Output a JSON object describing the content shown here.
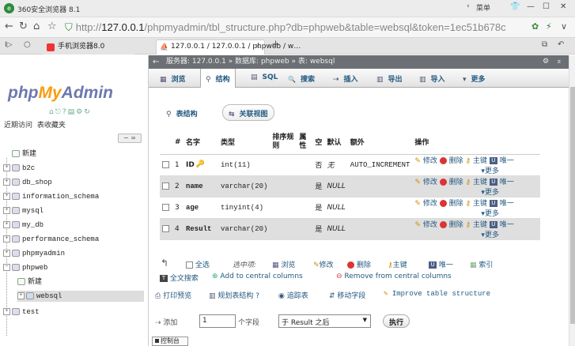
{
  "browser": {
    "title": "360安全浏览器 8.1",
    "menu_label": "菜单",
    "controls": {
      "minimize": "—",
      "maximize": "☐",
      "close": "✕"
    },
    "url_prefix": "http://",
    "url_host": "127.0.0.1",
    "url_rest": "/phpmyadmin/tbl_structure.php?db=phpweb&table=websql&token=1ec51b678c",
    "tabs": [
      {
        "label": "手机浏览器8.0",
        "active": false
      },
      {
        "label": "127.0.0.1 / 127.0.0.1 / phpweb / w…",
        "active": true
      }
    ],
    "new_tab": "+"
  },
  "left": {
    "logo_php": "php",
    "logo_my": "My",
    "logo_admin": "Admin",
    "recent": "近期访问",
    "favorites": "表收藏夹",
    "tree": [
      {
        "label": "新建",
        "expander": "",
        "level": 0
      },
      {
        "label": "b2c",
        "expander": "+",
        "level": 0
      },
      {
        "label": "db_shop",
        "expander": "+",
        "level": 0
      },
      {
        "label": "information_schema",
        "expander": "+",
        "level": 0
      },
      {
        "label": "mysql",
        "expander": "+",
        "level": 0
      },
      {
        "label": "my_db",
        "expander": "+",
        "level": 0
      },
      {
        "label": "performance_schema",
        "expander": "+",
        "level": 0
      },
      {
        "label": "phpmyadmin",
        "expander": "+",
        "level": 0
      },
      {
        "label": "phpweb",
        "expander": "−",
        "level": 0
      },
      {
        "label": "新建",
        "expander": "",
        "level": 1
      },
      {
        "label": "websql",
        "expander": "+",
        "level": 1
      },
      {
        "label": "test",
        "expander": "+",
        "level": 0
      }
    ]
  },
  "main": {
    "breadcrumb": "服务器: 127.0.0.1 » 数据库: phpweb » 表: websql",
    "menu": [
      {
        "icon": "▦",
        "label": "浏览"
      },
      {
        "icon": "⚲",
        "label": "结构",
        "active": true
      },
      {
        "icon": "▤",
        "label": "SQL"
      },
      {
        "icon": "🔍",
        "label": "搜索"
      },
      {
        "icon": "⇢",
        "label": "插入"
      },
      {
        "icon": "▥",
        "label": "导出"
      },
      {
        "icon": "▥",
        "label": "导入"
      },
      {
        "icon": "▾",
        "label": "更多"
      }
    ],
    "subtabs": {
      "structure": "表结构",
      "relation": "关联视图"
    },
    "table_headers": [
      "#",
      "名字",
      "类型",
      "排序规则",
      "属性",
      "空",
      "默认",
      "额外",
      "操作"
    ],
    "rows": [
      {
        "num": "1",
        "name": "ID",
        "pk": true,
        "type": "int(11)",
        "collation": "",
        "attr": "",
        "null": "否",
        "default": "无",
        "extra": "AUTO_INCREMENT"
      },
      {
        "num": "2",
        "name": "name",
        "pk": false,
        "type": "varchar(20)",
        "collation": "",
        "attr": "",
        "null": "是",
        "default": "NULL",
        "extra": ""
      },
      {
        "num": "3",
        "name": "age",
        "pk": false,
        "type": "tinyint(4)",
        "collation": "",
        "attr": "",
        "null": "是",
        "default": "NULL",
        "extra": ""
      },
      {
        "num": "4",
        "name": "Result",
        "pk": false,
        "type": "varchar(20)",
        "collation": "",
        "attr": "",
        "null": "是",
        "default": "NULL",
        "extra": ""
      }
    ],
    "row_actions": {
      "edit": "修改",
      "delete": "删除",
      "primary": "主键",
      "unique": "唯一",
      "more": "更多"
    },
    "bulk": {
      "check_all": "全选",
      "selected": "选中项:",
      "browse": "浏览",
      "edit": "修改",
      "delete": "删除",
      "primary": "主键",
      "unique": "唯一",
      "index": "索引",
      "fulltext": "全文搜索",
      "add_central": "Add to central columns",
      "remove_central": "Remove from central columns"
    },
    "tools": {
      "print": "打印预览",
      "plan": "规划表结构",
      "track": "追踪表",
      "move": "移动字段",
      "improve": "Improve table structure"
    },
    "add": {
      "label": "添加",
      "count": "1",
      "unit": "个字段",
      "position": "于 Result 之后",
      "exec": "执行"
    },
    "console": "控制台"
  }
}
